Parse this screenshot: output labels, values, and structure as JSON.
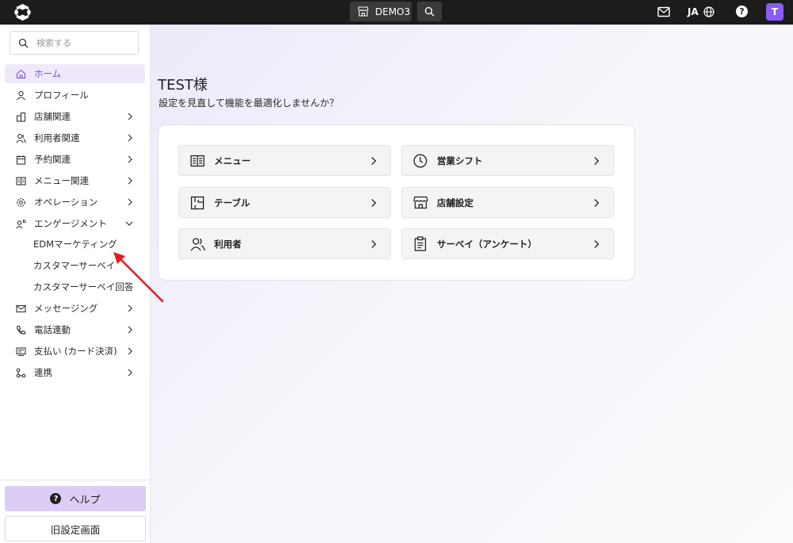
{
  "topbar": {
    "store_label": "DEMO3",
    "language": "JA",
    "help_symbol": "?",
    "avatar_initial": "T"
  },
  "sidebar": {
    "search_placeholder": "検索する",
    "items": [
      {
        "label": "ホーム",
        "icon": "home-icon"
      },
      {
        "label": "プロフィール",
        "icon": "user-icon"
      },
      {
        "label": "店舗関連",
        "icon": "building-icon"
      },
      {
        "label": "利用者関連",
        "icon": "users-icon"
      },
      {
        "label": "予約関連",
        "icon": "calendar-icon"
      },
      {
        "label": "メニュー関連",
        "icon": "menu-book-icon"
      },
      {
        "label": "オペレーション",
        "icon": "gear-icon"
      },
      {
        "label": "エンゲージメント",
        "icon": "engagement-icon"
      },
      {
        "label": "メッセージング",
        "icon": "mail-icon"
      },
      {
        "label": "電話連動",
        "icon": "phone-icon"
      },
      {
        "label": "支払い (カード決済)",
        "icon": "payment-icon"
      },
      {
        "label": "連携",
        "icon": "link-icon"
      }
    ],
    "engagement_sub": [
      "EDMマーケティング",
      "カスタマーサーベイ",
      "カスタマーサーベイ回答"
    ],
    "help_label": "ヘルプ",
    "old_settings_label": "旧設定画面"
  },
  "main": {
    "greeting": "TEST様",
    "subtitle": "設定を見直して機能を最適化しませんか？",
    "tiles": [
      {
        "label": "メニュー",
        "icon": "menu-book-icon"
      },
      {
        "label": "営業シフト",
        "icon": "clock-icon"
      },
      {
        "label": "テーブル",
        "icon": "table-icon"
      },
      {
        "label": "店舗設定",
        "icon": "store-icon"
      },
      {
        "label": "利用者",
        "icon": "users-icon"
      },
      {
        "label": "サーベイ（アンケート）",
        "icon": "clipboard-icon"
      }
    ]
  },
  "colors": {
    "accent": "#7c4ddb",
    "active_bg": "#efe9fb",
    "help_bg": "#dccdf7",
    "avatar": "#8b5cf6",
    "annotation_arrow": "#e02020"
  }
}
